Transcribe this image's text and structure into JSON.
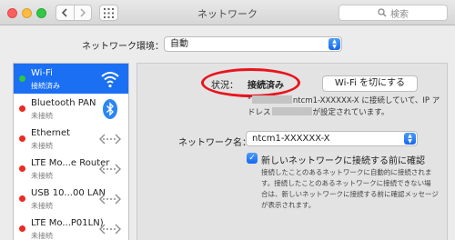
{
  "window": {
    "title": "ネットワーク"
  },
  "search": {
    "placeholder": "検索"
  },
  "location": {
    "label": "ネットワーク環境：",
    "value": "自動"
  },
  "services": [
    {
      "name": "Wi-Fi",
      "status": "接続済み",
      "indicator": "green",
      "icon": "wifi-icon"
    },
    {
      "name": "Bluetooth PAN",
      "status": "未接続",
      "indicator": "red",
      "icon": "bluetooth-icon"
    },
    {
      "name": "Ethernet",
      "status": "未接続",
      "indicator": "red",
      "icon": "ethernet-arrows-icon"
    },
    {
      "name": "LTE Mo...e Router",
      "status": "未接続",
      "indicator": "red",
      "icon": "ethernet-arrows-icon"
    },
    {
      "name": "USB 10...00 LAN",
      "status": "未接続",
      "indicator": "red",
      "icon": "ethernet-arrows-icon"
    },
    {
      "name": "LTE Mo...P01LN)",
      "status": "未接続",
      "indicator": "red",
      "icon": "ethernet-arrows-icon"
    }
  ],
  "detail": {
    "status_label": "状況：",
    "status_value": "接続済み",
    "wifi_off_button": "Wi-Fi を切にする",
    "description_line1_before": "\"",
    "description_line1_after": "ntcm1-XXXXXX-X に接続していて、IP ア",
    "description_line2_before": "ドレス",
    "description_line2_after": "が設定されています。",
    "network_name_label": "ネットワーク名：",
    "network_name_value": "ntcm1-XXXXXX-X",
    "ask_to_join_label": "新しいネットワークに接続する前に確認",
    "ask_to_join_checked": true,
    "help_lines": [
      "接続したことのあるネットワークに自動的に接続されま",
      "す。接続したことのあるネットワークに接続できない場",
      "合は、新しいネットワークに接続する前に確認メッセージ",
      "が表示されます。"
    ]
  },
  "colors": {
    "accent": "#1b6ff2",
    "highlight_circle": "#e8141e",
    "connected": "#2ec83e",
    "disconnected": "#ec2a23"
  }
}
